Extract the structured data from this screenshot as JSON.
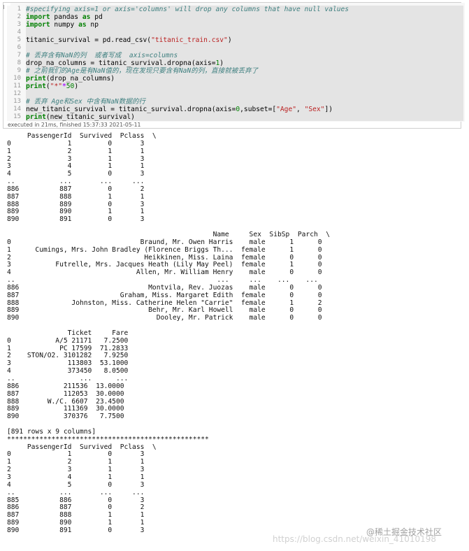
{
  "cell": {
    "line_numbers": [
      "1",
      "2",
      "3",
      "4",
      "5",
      "6",
      "7",
      "8",
      "9",
      "10",
      "11",
      "12",
      "13",
      "14",
      "15"
    ],
    "status": "executed in 21ms, finished 15:37:33 2021-05-11"
  },
  "code_lines": [
    [
      {
        "t": "#specifying axis=1 or axis='columns' will drop any columns that have null values",
        "c": "cm"
      }
    ],
    [
      {
        "t": "import",
        "c": "kw"
      },
      {
        "t": " pandas ",
        "c": ""
      },
      {
        "t": "as",
        "c": "kw"
      },
      {
        "t": " pd",
        "c": ""
      }
    ],
    [
      {
        "t": "import",
        "c": "kw"
      },
      {
        "t": " numpy ",
        "c": ""
      },
      {
        "t": "as",
        "c": "kw"
      },
      {
        "t": " np",
        "c": ""
      }
    ],
    [],
    [
      {
        "t": "titanic_survival = pd.read_csv(",
        "c": ""
      },
      {
        "t": "\"titanic_train.csv\"",
        "c": "st"
      },
      {
        "t": ")",
        "c": ""
      }
    ],
    [],
    [
      {
        "t": "# 丢弃含有NaN的列  或者写成  axis=columns",
        "c": "cm"
      }
    ],
    [
      {
        "t": "drop_na_columns = titanic_survival.dropna(axis=",
        "c": ""
      },
      {
        "t": "1",
        "c": "nm"
      },
      {
        "t": ")",
        "c": ""
      }
    ],
    [
      {
        "t": "# 之前我们的Age是有NaN值的，现在发现只要含有NaN的列，直接就被丢弃了",
        "c": "cm"
      }
    ],
    [
      {
        "t": "print",
        "c": "kw"
      },
      {
        "t": "(drop_na_columns)",
        "c": ""
      }
    ],
    [
      {
        "t": "print",
        "c": "kw"
      },
      {
        "t": "(",
        "c": ""
      },
      {
        "t": "\"*\"",
        "c": "st"
      },
      {
        "t": "*",
        "c": "op"
      },
      {
        "t": "50",
        "c": "nm"
      },
      {
        "t": ")",
        "c": ""
      }
    ],
    [],
    [
      {
        "t": "# 丢弃 Age和Sex 中含有NaN数据的行",
        "c": "cm"
      }
    ],
    [
      {
        "t": "new_titanic_survival = titanic_survival.dropna(axis=",
        "c": ""
      },
      {
        "t": "0",
        "c": "nm"
      },
      {
        "t": ",subset=[",
        "c": ""
      },
      {
        "t": "\"Age\"",
        "c": "st"
      },
      {
        "t": ", ",
        "c": ""
      },
      {
        "t": "\"Sex\"",
        "c": "st"
      },
      {
        "t": "])",
        "c": ""
      }
    ],
    [
      {
        "t": "print",
        "c": "kw"
      },
      {
        "t": "(new_titanic_survival)",
        "c": ""
      }
    ]
  ],
  "output_lines": [
    "     PassengerId  Survived  Pclass  \\",
    "0              1         0       3",
    "1              2         1       1",
    "2              3         1       3",
    "3              4         1       1",
    "4              5         0       3",
    "..           ...       ...     ...",
    "886          887         0       2",
    "887          888         1       1",
    "888          889         0       3",
    "889          890         1       1",
    "890          891         0       3",
    "",
    "                                                   Name     Sex  SibSp  Parch  \\",
    "0                                Braund, Mr. Owen Harris    male      1      0",
    "1      Cumings, Mrs. John Bradley (Florence Briggs Th...  female      1      0",
    "2                                 Heikkinen, Miss. Laina  female      0      0",
    "3           Futrelle, Mrs. Jacques Heath (Lily May Peel)  female      1      0",
    "4                               Allen, Mr. William Henry    male      0      0",
    "..                                                  ...     ...    ...    ...",
    "886                                Montvila, Rev. Juozas    male      0      0",
    "887                         Graham, Miss. Margaret Edith  female      0      0",
    "888             Johnston, Miss. Catherine Helen \"Carrie\"  female      1      2",
    "889                                Behr, Mr. Karl Howell    male      0      0",
    "890                                  Dooley, Mr. Patrick    male      0      0",
    "",
    "               Ticket     Fare",
    "0           A/5 21171   7.2500",
    "1            PC 17599  71.2833",
    "2    STON/O2. 3101282   7.9250",
    "3              113803  53.1000",
    "4              373450   8.0500",
    "..                ...      ...",
    "886           211536  13.0000",
    "887           112053  30.0000",
    "888       W./C. 6607  23.4500",
    "889           111369  30.0000",
    "890           370376   7.7500",
    "",
    "[891 rows x 9 columns]",
    "**************************************************",
    "     PassengerId  Survived  Pclass  \\",
    "0              1         0       3",
    "1              2         1       1",
    "2              3         1       3",
    "3              4         1       1",
    "4              5         0       3",
    "..           ...       ...     ...",
    "885          886         0       3",
    "886          887         0       2",
    "887          888         1       1",
    "889          890         1       1",
    "890          891         0       3"
  ],
  "watermark": {
    "logo_text": "@稀土掘金技术社区",
    "url_text": "https://blog.csdn.net/weixin_41010198"
  }
}
